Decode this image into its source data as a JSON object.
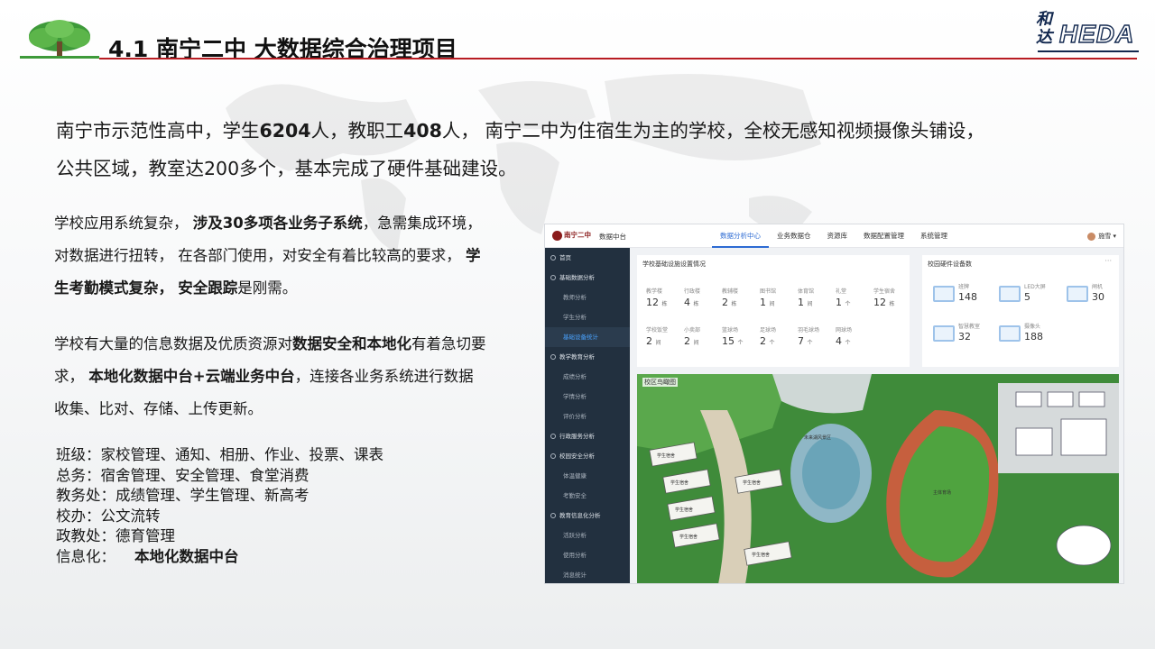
{
  "slide": {
    "title": "4.1 南宁二中  大数据综合治理项目",
    "brand_cn": "和达",
    "brand_en": "HEDA"
  },
  "intro": {
    "line1_a": "南宁市示范性高中，学生",
    "line1_b": "6204",
    "line1_c": "人，教职工",
    "line1_d": "408",
    "line1_e": "人，   南宁二中为住宿生为主的学校，全校无感知视频摄像头铺设，",
    "line2": "公共区域，教室达200多个，基本完成了硬件基础建设。"
  },
  "para1": {
    "a": "学校应用系统复杂，  ",
    "b": "涉及30多项各业务子系统",
    "c": "，急需集成环境，对数据进行扭转，  在各部门使用，对安全有着比较高的要求，  ",
    "d": "学生考勤模式复杂，",
    "e": "  ",
    "f": "安全跟踪",
    "g": "是刚需。"
  },
  "para2": {
    "a": "学校有大量的信息数据及优质资源对",
    "b": "数据安全和本地化",
    "c": "有着急切要求，  ",
    "d": "本地化数据中台+云端业务中台",
    "e": "，连接各业务系统进行数据收集、比对、存储、上传更新。"
  },
  "list": {
    "items": [
      "班级：家校管理、通知、相册、作业、投票、课表",
      "总务：宿舍管理、安全管理、食堂消费",
      "教务处：成绩管理、学生管理、新高考",
      "校办：公文流转",
      "政教处：德育管理"
    ],
    "last_label": "信息化：",
    "last_value": "本地化数据中台"
  },
  "app": {
    "logo": "南宁二中",
    "name": "数据中台",
    "nav": [
      "数据分析中心",
      "业务数据仓",
      "资源库",
      "数据配置管理",
      "系统管理"
    ],
    "user": "施雪",
    "sidebar": [
      {
        "label": "首页",
        "kind": "group"
      },
      {
        "label": "基础数据分析",
        "kind": "group"
      },
      {
        "label": "教师分析",
        "kind": "sub"
      },
      {
        "label": "学生分析",
        "kind": "sub"
      },
      {
        "label": "基础设备统计",
        "kind": "sub-active"
      },
      {
        "label": "教学教育分析",
        "kind": "group"
      },
      {
        "label": "成绩分析",
        "kind": "sub"
      },
      {
        "label": "学情分析",
        "kind": "sub"
      },
      {
        "label": "评价分析",
        "kind": "sub"
      },
      {
        "label": "行政服务分析",
        "kind": "group"
      },
      {
        "label": "校园安全分析",
        "kind": "group"
      },
      {
        "label": "体温健康",
        "kind": "sub"
      },
      {
        "label": "考勤安全",
        "kind": "sub"
      },
      {
        "label": "教育信息化分析",
        "kind": "group"
      },
      {
        "label": "活跃分析",
        "kind": "sub"
      },
      {
        "label": "使用分析",
        "kind": "sub"
      },
      {
        "label": "消息统计",
        "kind": "sub"
      }
    ],
    "facilities": {
      "title": "学校基础设施设置情况",
      "row1": [
        {
          "label": "教学楼",
          "value": "12",
          "unit": "栋"
        },
        {
          "label": "行政楼",
          "value": "4",
          "unit": "栋"
        },
        {
          "label": "教辅楼",
          "value": "2",
          "unit": "栋"
        },
        {
          "label": "图书馆",
          "value": "1",
          "unit": "间"
        },
        {
          "label": "体育馆",
          "value": "1",
          "unit": "间"
        },
        {
          "label": "礼堂",
          "value": "1",
          "unit": "个"
        },
        {
          "label": "学生宿舍",
          "value": "12",
          "unit": "栋"
        }
      ],
      "row2": [
        {
          "label": "学校饭堂",
          "value": "2",
          "unit": "间"
        },
        {
          "label": "小卖部",
          "value": "2",
          "unit": "间"
        },
        {
          "label": "篮球场",
          "value": "15",
          "unit": "个"
        },
        {
          "label": "足球场",
          "value": "2",
          "unit": "个"
        },
        {
          "label": "羽毛球场",
          "value": "7",
          "unit": "个"
        },
        {
          "label": "网球场",
          "value": "4",
          "unit": "个"
        }
      ]
    },
    "hardware": {
      "title": "校园硬件设备数",
      "more": "···",
      "items": [
        {
          "label": "班牌",
          "value": "148"
        },
        {
          "label": "LED大屏",
          "value": "5"
        },
        {
          "label": "闸机",
          "value": "30"
        },
        {
          "label": "智慧教室",
          "value": "32"
        },
        {
          "label": "摄像头",
          "value": "188"
        }
      ]
    },
    "map": {
      "title": "校区鸟瞰图",
      "labels": [
        "学生宿舍",
        "学生宿舍",
        "学生宿舍",
        "学生宿舍",
        "学生宿舍",
        "学生宿舍",
        "主体育场",
        "未来湖风景区"
      ]
    }
  }
}
